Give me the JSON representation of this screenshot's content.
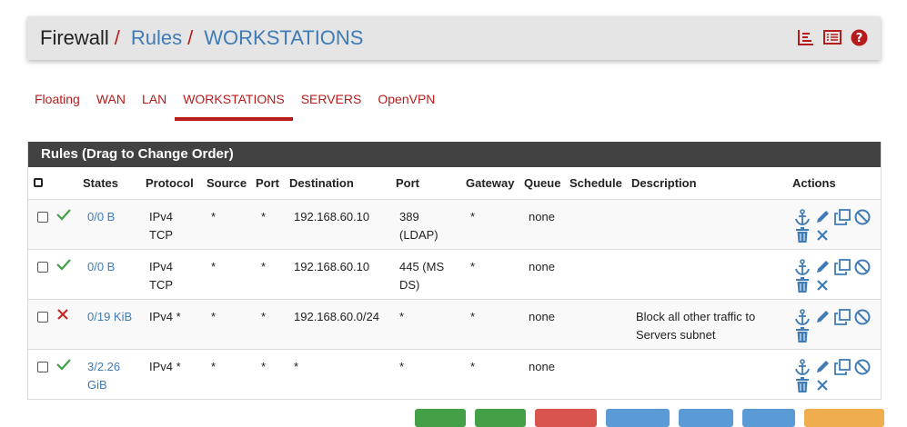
{
  "breadcrumb": {
    "firewall": "Firewall",
    "sep": "/",
    "rules": "Rules",
    "interface": "WORKSTATIONS"
  },
  "header_icons": [
    "chart-icon",
    "list-icon",
    "help-icon"
  ],
  "tabs": [
    {
      "label": "Floating",
      "active": false
    },
    {
      "label": "WAN",
      "active": false
    },
    {
      "label": "LAN",
      "active": false
    },
    {
      "label": "WORKSTATIONS",
      "active": true
    },
    {
      "label": "SERVERS",
      "active": false
    },
    {
      "label": "OpenVPN",
      "active": false
    }
  ],
  "panel": {
    "title": "Rules (Drag to Change Order)"
  },
  "columns": [
    "States",
    "Protocol",
    "Source",
    "Port",
    "Destination",
    "Port",
    "Gateway",
    "Queue",
    "Schedule",
    "Description",
    "Actions"
  ],
  "rows": [
    {
      "status": "pass",
      "states": "0/0 B",
      "protocol_l1": "IPv4",
      "protocol_l2": "TCP",
      "source": "*",
      "sport": "*",
      "destination": "192.168.60.10",
      "dport_l1": "389",
      "dport_l2": "(LDAP)",
      "gateway": "*",
      "queue": "none",
      "schedule": "",
      "desc_l1": "",
      "desc_l2": ""
    },
    {
      "status": "pass",
      "states": "0/0 B",
      "protocol_l1": "IPv4",
      "protocol_l2": "TCP",
      "source": "*",
      "sport": "*",
      "destination": "192.168.60.10",
      "dport_l1": "445 (MS",
      "dport_l2": "DS)",
      "gateway": "*",
      "queue": "none",
      "schedule": "",
      "desc_l1": "",
      "desc_l2": ""
    },
    {
      "status": "block",
      "states": "0/19 KiB",
      "protocol_l1": "IPv4 *",
      "protocol_l2": "",
      "source": "*",
      "sport": "*",
      "destination": "192.168.60.0/24",
      "dport_l1": "*",
      "dport_l2": "",
      "gateway": "*",
      "queue": "none",
      "schedule": "",
      "desc_l1": "Block all other traffic to",
      "desc_l2": "Servers subnet"
    },
    {
      "status": "pass",
      "states_l1": "3/2.26",
      "states_l2": "GiB",
      "protocol_l1": "IPv4 *",
      "protocol_l2": "",
      "source": "*",
      "sport": "*",
      "destination": "*",
      "dport_l1": "*",
      "dport_l2": "",
      "gateway": "*",
      "queue": "none",
      "schedule": "",
      "desc_l1": "",
      "desc_l2": ""
    }
  ],
  "colors": {
    "accent": "#b71c1c",
    "link": "#3f7bb5",
    "pass": "#43a047",
    "block": "#c62828",
    "panel_head": "#424242"
  }
}
